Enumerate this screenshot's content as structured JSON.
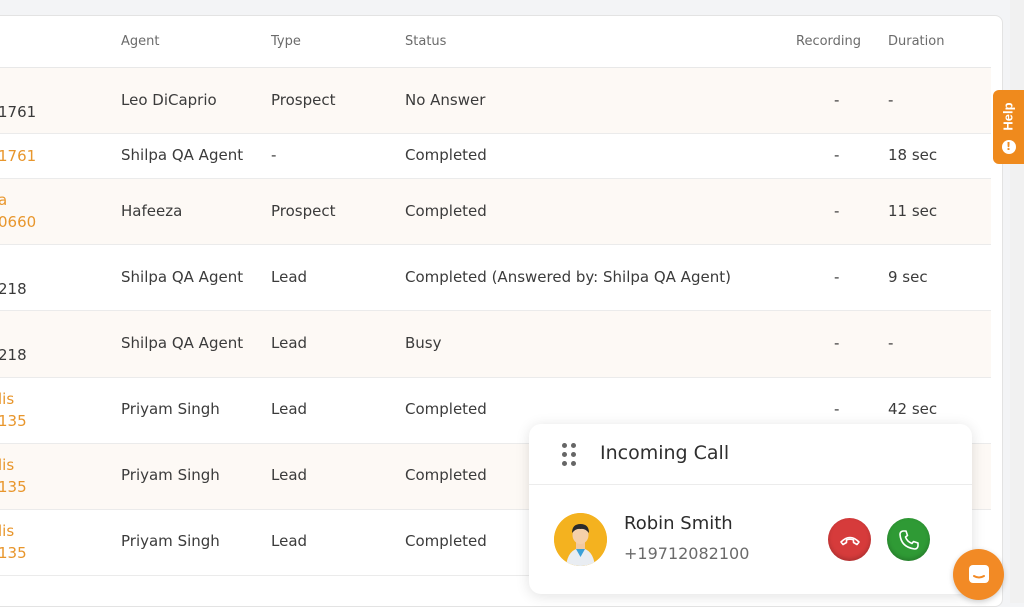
{
  "table": {
    "headers": {
      "agent": "Agent",
      "type": "Type",
      "status": "Status",
      "recording": "Recording",
      "duration": "Duration"
    },
    "rows": [
      {
        "num1": "",
        "num2": "1761",
        "num_color": "dark",
        "agent": "Leo DiCaprio",
        "type": "Prospect",
        "status": "No Answer",
        "recording": "-",
        "duration": "-"
      },
      {
        "num1": "1761",
        "num2": "",
        "num_color": "orange",
        "agent": "Shilpa QA Agent",
        "type": "-",
        "status": "Completed",
        "recording": "-",
        "duration": "18 sec"
      },
      {
        "num1": "a",
        "num2": "0660",
        "num_color": "orange",
        "agent": "Hafeeza",
        "type": "Prospect",
        "status": "Completed",
        "recording": "-",
        "duration": "11 sec"
      },
      {
        "num1": "",
        "num2": "218",
        "num_color": "dark",
        "agent": "Shilpa QA Agent",
        "type": "Lead",
        "status": "Completed (Answered by: Shilpa QA Agent)",
        "recording": "-",
        "duration": "9 sec"
      },
      {
        "num1": "",
        "num2": "218",
        "num_color": "dark",
        "agent": "Shilpa QA Agent",
        "type": "Lead",
        "status": "Busy",
        "recording": "-",
        "duration": "-"
      },
      {
        "num1": "lis",
        "num2": "135",
        "num_color": "orange",
        "agent": "Priyam Singh",
        "type": "Lead",
        "status": "Completed",
        "recording": "-",
        "duration": "42 sec"
      },
      {
        "num1": "lis",
        "num2": "135",
        "num_color": "orange",
        "agent": "Priyam Singh",
        "type": "Lead",
        "status": "Completed",
        "recording": "",
        "duration": ""
      },
      {
        "num1": "lis",
        "num2": "135",
        "num_color": "orange",
        "agent": "Priyam Singh",
        "type": "Lead",
        "status": "Completed",
        "recording": "",
        "duration": ""
      }
    ]
  },
  "help": {
    "label": "Help",
    "icon": "exclamation-icon",
    "glyph": "!"
  },
  "call": {
    "title": "Incoming Call",
    "caller_name": "Robin Smith",
    "caller_number": "+19712082100",
    "decline_icon": "phone-hangup-icon",
    "accept_icon": "phone-icon"
  },
  "chat": {
    "icon": "chat-icon"
  },
  "colors": {
    "accent_orange": "#ef8a1d",
    "decline_red": "#d63b3b",
    "accept_green": "#2f9a35",
    "avatar_yellow": "#f4b21f"
  }
}
